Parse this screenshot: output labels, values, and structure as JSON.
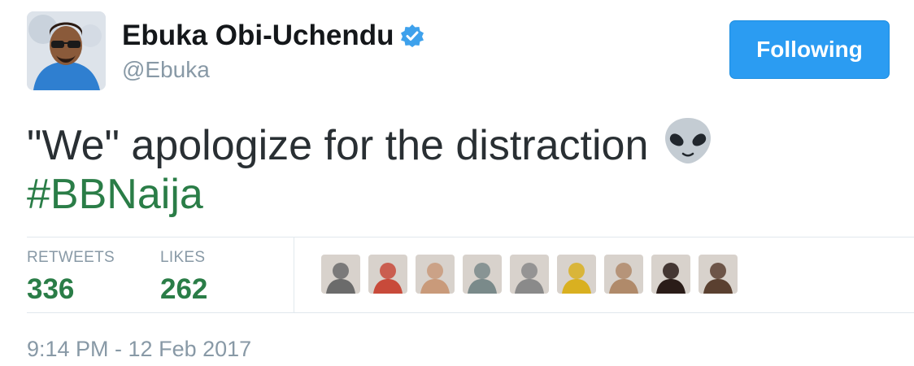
{
  "user": {
    "name": "Ebuka Obi-Uchendu",
    "handle": "@Ebuka",
    "verified": true
  },
  "follow_button": {
    "label": "Following"
  },
  "tweet": {
    "text": "\"We\" apologize for the distraction",
    "emoji": "alien-icon",
    "hashtag": "#BBNaija"
  },
  "stats": {
    "retweets_label": "RETWEETS",
    "retweets_value": "336",
    "likes_label": "LIKES",
    "likes_value": "262"
  },
  "likers": [
    {
      "name": "liker-avatar-1",
      "color": "#6b6b6b"
    },
    {
      "name": "liker-avatar-2",
      "color": "#c84a3a"
    },
    {
      "name": "liker-avatar-3",
      "color": "#c99a7a"
    },
    {
      "name": "liker-avatar-4",
      "color": "#7a8a8a"
    },
    {
      "name": "liker-avatar-5",
      "color": "#8a8a8a"
    },
    {
      "name": "liker-avatar-6",
      "color": "#d9b020"
    },
    {
      "name": "liker-avatar-7",
      "color": "#b08a6a"
    },
    {
      "name": "liker-avatar-8",
      "color": "#2a1c18"
    },
    {
      "name": "liker-avatar-9",
      "color": "#5a4030"
    }
  ],
  "timestamp": "9:14 PM - 12 Feb 2017",
  "colors": {
    "accent_blue": "#2b9cf2",
    "hashtag_green": "#2a7d47",
    "muted_gray": "#8899a6"
  }
}
